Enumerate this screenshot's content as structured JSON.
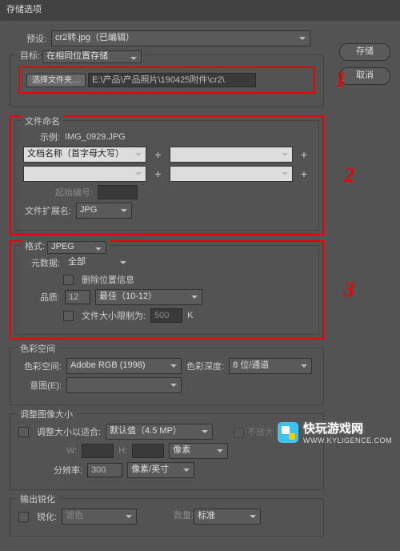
{
  "title": "存储选项",
  "btn_save": "存储",
  "btn_cancel": "取消",
  "preset_lbl": "预设:",
  "preset_val": "cr2转.jpg（已编辑）",
  "dest_lbl": "目标:",
  "dest_val": "在相同位置存储",
  "browse_btn": "选择文件夹…",
  "path": "E:\\产品\\产品照片\\190425附件\\cr2\\",
  "fnaming": "文件命名",
  "example_lbl": "示例:",
  "example_val": "IMG_0929.JPG",
  "name_scheme": "文档名称（首字母大写）",
  "start_lbl": "起始编号:",
  "ext_lbl": "文件扩展名:",
  "ext_val": "JPG",
  "fmt_lbl": "格式:",
  "fmt_val": "JPEG",
  "meta_lbl": "元数据:",
  "meta_val": "全部",
  "del_loc": "删除位置信息",
  "qual_lbl": "品质:",
  "qual_num": "12",
  "qual_range": "最佳（10-12）",
  "limit_lbl": "文件大小限制为:",
  "limit_val": "500",
  "limit_unit": "K",
  "cs_title": "色彩空间",
  "cs_lbl": "色彩空间:",
  "cs_val": "Adobe RGB (1998)",
  "depth_lbl": "色彩深度:",
  "depth_val": "8 位/通道",
  "intent_lbl": "意图(E):",
  "rs_title": "调整图像大小",
  "rs_fit": "调整大小以适合:",
  "rs_val": "默认值（4.5 MP）",
  "rs_noup": "不放大",
  "w_lbl": "W:",
  "h_lbl": "H:",
  "unit_px": "像素",
  "res_lbl": "分辨率:",
  "res_val": "300",
  "res_unit": "像素/英寸",
  "sharp_title": "输出锐化",
  "sharp_lbl": "锐化:",
  "sharp_val": "滤色",
  "amt_lbl": "数量:",
  "amt_val": "标准",
  "r1": "1",
  "r2": "2",
  "r3": "3",
  "wm": "快玩游戏网",
  "wm_url": "WWW.KYLIGENCE.COM"
}
